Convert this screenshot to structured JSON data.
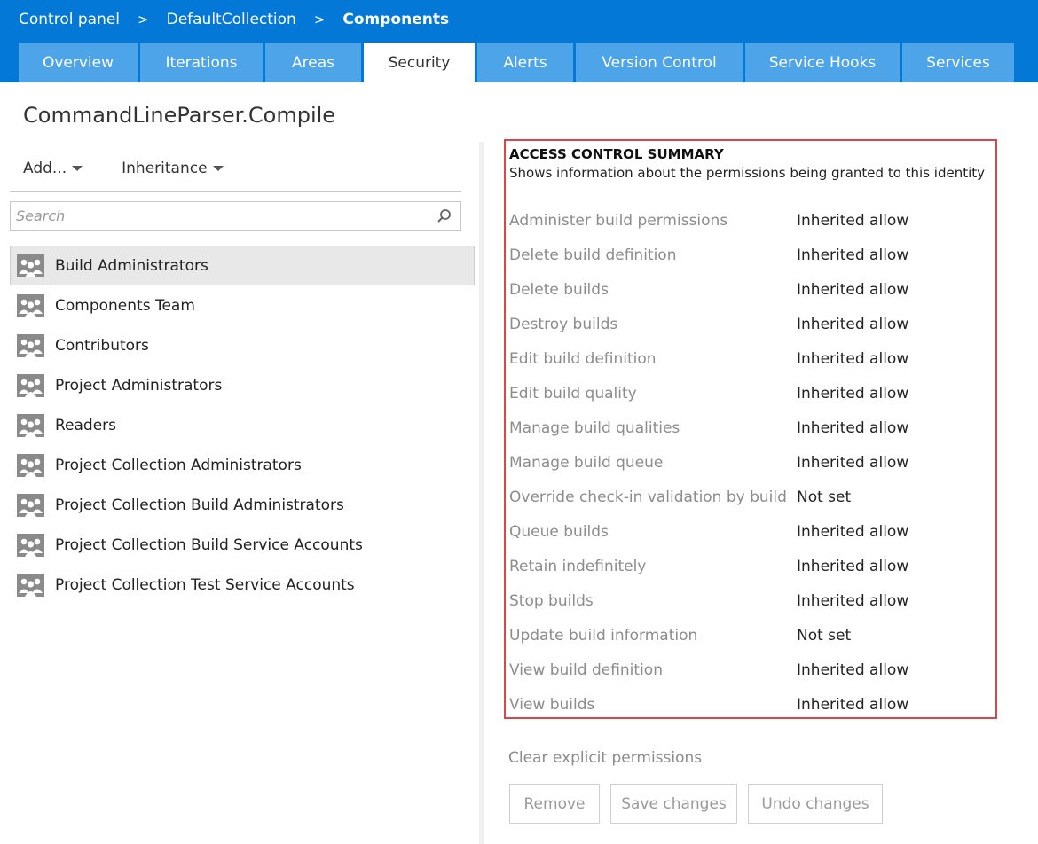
{
  "breadcrumb": {
    "items": [
      "Control panel",
      "DefaultCollection",
      "Components"
    ],
    "separator": ">"
  },
  "tabs": [
    {
      "label": "Overview"
    },
    {
      "label": "Iterations"
    },
    {
      "label": "Areas"
    },
    {
      "label": "Security",
      "active": true
    },
    {
      "label": "Alerts"
    },
    {
      "label": "Version Control"
    },
    {
      "label": "Service Hooks"
    },
    {
      "label": "Services"
    }
  ],
  "page_title": "CommandLineParser.Compile",
  "left_pane": {
    "add_label": "Add...",
    "inheritance_label": "Inheritance",
    "search_placeholder": "Search",
    "groups": [
      "Build Administrators",
      "Components Team",
      "Contributors",
      "Project Administrators",
      "Readers",
      "Project Collection Administrators",
      "Project Collection Build Administrators",
      "Project Collection Build Service Accounts",
      "Project Collection Test Service Accounts"
    ],
    "selected_group": "Build Administrators"
  },
  "access_control": {
    "title": "ACCESS CONTROL SUMMARY",
    "description": "Shows information about the permissions being granted to this identity",
    "permissions": [
      {
        "name": "Administer build permissions",
        "value": "Inherited allow"
      },
      {
        "name": "Delete build definition",
        "value": "Inherited allow"
      },
      {
        "name": "Delete builds",
        "value": "Inherited allow"
      },
      {
        "name": "Destroy builds",
        "value": "Inherited allow"
      },
      {
        "name": "Edit build definition",
        "value": "Inherited allow"
      },
      {
        "name": "Edit build quality",
        "value": "Inherited allow"
      },
      {
        "name": "Manage build qualities",
        "value": "Inherited allow"
      },
      {
        "name": "Manage build queue",
        "value": "Inherited allow"
      },
      {
        "name": "Override check-in validation by build",
        "value": "Not set"
      },
      {
        "name": "Queue builds",
        "value": "Inherited allow"
      },
      {
        "name": "Retain indefinitely",
        "value": "Inherited allow"
      },
      {
        "name": "Stop builds",
        "value": "Inherited allow"
      },
      {
        "name": "Update build information",
        "value": "Not set"
      },
      {
        "name": "View build definition",
        "value": "Inherited allow"
      },
      {
        "name": "View builds",
        "value": "Inherited allow"
      }
    ]
  },
  "footer": {
    "clear_label": "Clear explicit permissions",
    "remove_label": "Remove",
    "save_label": "Save changes",
    "undo_label": "Undo changes"
  },
  "colors": {
    "header_bg": "#0478d7",
    "tab_bg": "#4da4e8",
    "highlight_border": "#d9464b"
  },
  "icons": {
    "search": "search-icon",
    "group": "group-icon",
    "dropdown": "caret-down-icon"
  }
}
